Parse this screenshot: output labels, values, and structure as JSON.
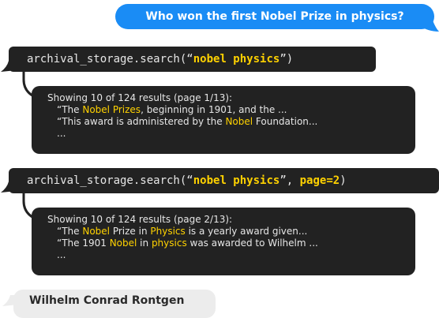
{
  "user_message": "Who won the first Nobel Prize in physics?",
  "calls": [
    {
      "fn": "archival_storage.search",
      "open": "(“",
      "query": "nobel physics",
      "close_quote": "”",
      "sep": ", ",
      "kwarg": "",
      "close": ")"
    },
    {
      "fn": "archival_storage.search",
      "open": "(“",
      "query": "nobel physics",
      "close_quote": "”",
      "sep": ", ",
      "kwarg": "page=2",
      "close": ")"
    }
  ],
  "results": [
    {
      "header": "Showing 10 of 124 results (page 1/13):",
      "line1": {
        "pre": "“The ",
        "mark": "Nobel Prizes",
        "post": ", beginning in 1901, and the ..."
      },
      "line2": {
        "pre": "“This award is administered by the ",
        "mark": "Nobel",
        "post": " Foundation..."
      },
      "ellipsis": "..."
    },
    {
      "header": "Showing 10 of 124 results (page 2/13):",
      "line1": {
        "pre": "“The ",
        "mark": "Nobel",
        "mid": " Prize in ",
        "mark2": "Physics",
        "post": " is a yearly award given..."
      },
      "line2": {
        "pre": "“The 1901 ",
        "mark": "Nobel",
        "mid": " in ",
        "mark2": "physics",
        "post": " was awarded to Wilhelm ..."
      },
      "ellipsis": "..."
    }
  ],
  "answer": "Wilhelm Conrad Rontgen",
  "colors": {
    "user_bubble": "#1a8cf5",
    "dark_panel": "#222222",
    "highlight": "#ffd200",
    "answer_bubble": "#ececec"
  }
}
